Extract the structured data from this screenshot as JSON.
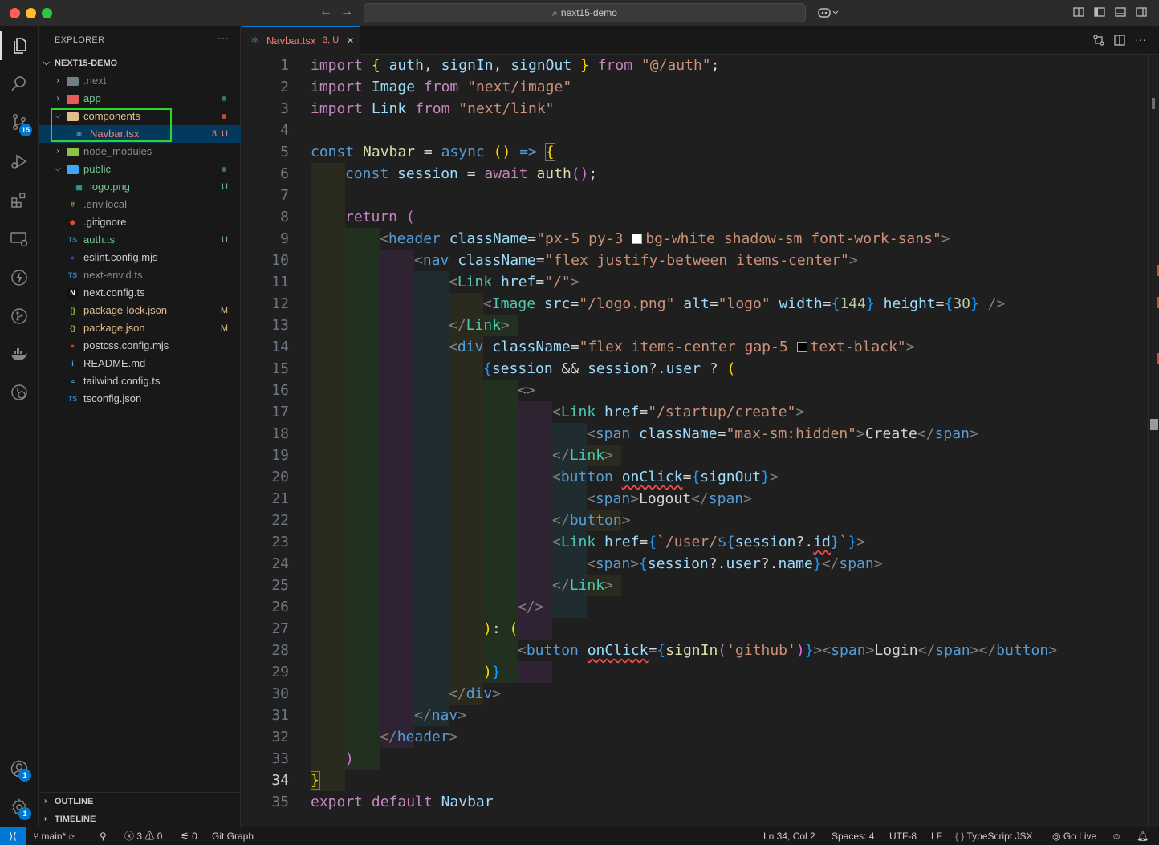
{
  "titlebar": {
    "search_text": "next15-demo",
    "back_icon": "arrow-left-icon",
    "forward_icon": "arrow-right-icon"
  },
  "activitybar": {
    "scm_badge": "15",
    "accounts_badge": "1",
    "settings_badge": "1"
  },
  "explorer": {
    "title": "EXPLORER",
    "more": "···",
    "project": "NEXT15-DEMO",
    "items": [
      {
        "name": ".next",
        "status": "",
        "color": "#8b8b8b"
      },
      {
        "name": "app",
        "status": "",
        "color": "#73c991"
      },
      {
        "name": "components",
        "status": "",
        "color": "#e2c08d"
      },
      {
        "name": "Navbar.tsx",
        "status": "3, U",
        "color": "#f88070"
      },
      {
        "name": "node_modules",
        "status": "",
        "color": "#8b8b8b"
      },
      {
        "name": "public",
        "status": "",
        "color": "#73c991"
      },
      {
        "name": "logo.png",
        "status": "U",
        "color": "#73c991"
      },
      {
        "name": ".env.local",
        "status": "",
        "color": "#8b8b8b"
      },
      {
        "name": ".gitignore",
        "status": "",
        "color": "#cccccc"
      },
      {
        "name": "auth.ts",
        "status": "U",
        "color": "#73c991"
      },
      {
        "name": "eslint.config.mjs",
        "status": "",
        "color": "#cccccc"
      },
      {
        "name": "next-env.d.ts",
        "status": "",
        "color": "#8b8b8b"
      },
      {
        "name": "next.config.ts",
        "status": "",
        "color": "#cccccc"
      },
      {
        "name": "package-lock.json",
        "status": "M",
        "color": "#e2c08d"
      },
      {
        "name": "package.json",
        "status": "M",
        "color": "#e2c08d"
      },
      {
        "name": "postcss.config.mjs",
        "status": "",
        "color": "#cccccc"
      },
      {
        "name": "README.md",
        "status": "",
        "color": "#cccccc"
      },
      {
        "name": "tailwind.config.ts",
        "status": "",
        "color": "#cccccc"
      },
      {
        "name": "tsconfig.json",
        "status": "",
        "color": "#cccccc"
      }
    ],
    "outline": "OUTLINE",
    "timeline": "TIMELINE"
  },
  "tab": {
    "name": "Navbar.tsx",
    "status": "3, U",
    "close": "×"
  },
  "editor": {
    "current_line": 34,
    "line_numbers": [
      "1",
      "2",
      "3",
      "4",
      "5",
      "6",
      "7",
      "8",
      "9",
      "10",
      "11",
      "12",
      "13",
      "14",
      "15",
      "16",
      "17",
      "18",
      "19",
      "20",
      "21",
      "22",
      "23",
      "24",
      "25",
      "26",
      "27",
      "28",
      "29",
      "30",
      "31",
      "32",
      "33",
      "34",
      "35"
    ]
  },
  "statusbar": {
    "branch": "main*",
    "errors": "3",
    "warnings": "0",
    "ports": "0",
    "git_graph": "Git Graph",
    "position": "Ln 34, Col 2",
    "spaces": "Spaces: 4",
    "encoding": "UTF-8",
    "eol": "LF",
    "language": "TypeScript JSX",
    "golive": "Go Live"
  },
  "colors": {
    "accent": "#0078d4",
    "highlight_box": "#2fd42f"
  }
}
